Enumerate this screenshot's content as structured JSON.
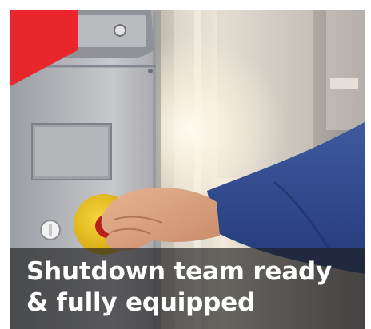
{
  "caption": {
    "line1": "Shutdown team ready",
    "line2": "& fully equipped"
  },
  "colors": {
    "corner_accent": "#e8262c",
    "caption_text": "#ffffff"
  },
  "image": {
    "subject": "photo-of-hand-pressing-emergency-stop-button"
  }
}
